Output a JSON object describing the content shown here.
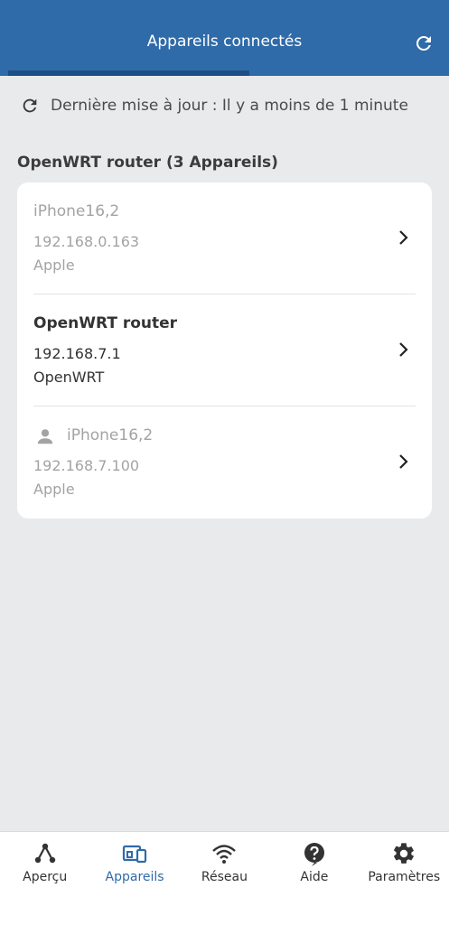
{
  "header": {
    "title": "Appareils connectés"
  },
  "update": {
    "text": "Dernière mise à jour : Il y a moins de 1 minute"
  },
  "group": {
    "title": "OpenWRT router (3 Appareils)"
  },
  "devices": [
    {
      "name": "iPhone16,2",
      "ip": "192.168.0.163",
      "vendor": "Apple",
      "icon": ""
    },
    {
      "name": "OpenWRT router",
      "ip": "192.168.7.1",
      "vendor": "OpenWRT",
      "icon": ""
    },
    {
      "name": "iPhone16,2",
      "ip": "192.168.7.100",
      "vendor": "Apple",
      "icon": "person-icon"
    }
  ],
  "nav": [
    {
      "label": "Aperçu",
      "icon": "overview-icon"
    },
    {
      "label": "Appareils",
      "icon": "devices-icon"
    },
    {
      "label": "Réseau",
      "icon": "wifi-icon"
    },
    {
      "label": "Aide",
      "icon": "help-icon"
    },
    {
      "label": "Paramètres",
      "icon": "gear-icon"
    }
  ],
  "colors": {
    "primary": "#2f6ba9",
    "background": "#e9eaec"
  }
}
